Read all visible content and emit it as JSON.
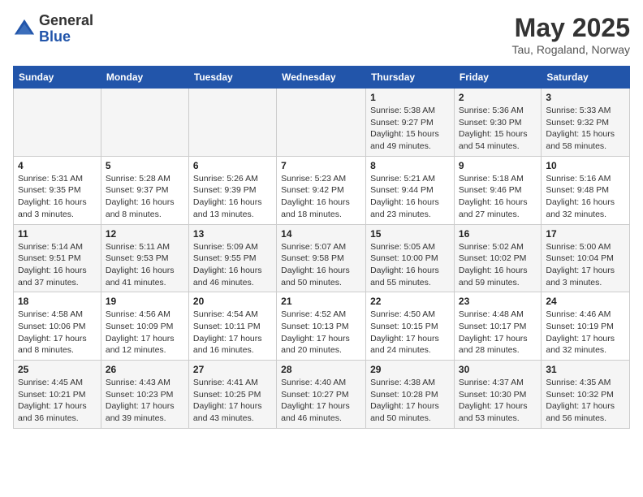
{
  "header": {
    "logo_general": "General",
    "logo_blue": "Blue",
    "month_title": "May 2025",
    "location": "Tau, Rogaland, Norway"
  },
  "days_of_week": [
    "Sunday",
    "Monday",
    "Tuesday",
    "Wednesday",
    "Thursday",
    "Friday",
    "Saturday"
  ],
  "weeks": [
    [
      {
        "day": "",
        "info": ""
      },
      {
        "day": "",
        "info": ""
      },
      {
        "day": "",
        "info": ""
      },
      {
        "day": "",
        "info": ""
      },
      {
        "day": "1",
        "info": "Sunrise: 5:38 AM\nSunset: 9:27 PM\nDaylight: 15 hours\nand 49 minutes."
      },
      {
        "day": "2",
        "info": "Sunrise: 5:36 AM\nSunset: 9:30 PM\nDaylight: 15 hours\nand 54 minutes."
      },
      {
        "day": "3",
        "info": "Sunrise: 5:33 AM\nSunset: 9:32 PM\nDaylight: 15 hours\nand 58 minutes."
      }
    ],
    [
      {
        "day": "4",
        "info": "Sunrise: 5:31 AM\nSunset: 9:35 PM\nDaylight: 16 hours\nand 3 minutes."
      },
      {
        "day": "5",
        "info": "Sunrise: 5:28 AM\nSunset: 9:37 PM\nDaylight: 16 hours\nand 8 minutes."
      },
      {
        "day": "6",
        "info": "Sunrise: 5:26 AM\nSunset: 9:39 PM\nDaylight: 16 hours\nand 13 minutes."
      },
      {
        "day": "7",
        "info": "Sunrise: 5:23 AM\nSunset: 9:42 PM\nDaylight: 16 hours\nand 18 minutes."
      },
      {
        "day": "8",
        "info": "Sunrise: 5:21 AM\nSunset: 9:44 PM\nDaylight: 16 hours\nand 23 minutes."
      },
      {
        "day": "9",
        "info": "Sunrise: 5:18 AM\nSunset: 9:46 PM\nDaylight: 16 hours\nand 27 minutes."
      },
      {
        "day": "10",
        "info": "Sunrise: 5:16 AM\nSunset: 9:48 PM\nDaylight: 16 hours\nand 32 minutes."
      }
    ],
    [
      {
        "day": "11",
        "info": "Sunrise: 5:14 AM\nSunset: 9:51 PM\nDaylight: 16 hours\nand 37 minutes."
      },
      {
        "day": "12",
        "info": "Sunrise: 5:11 AM\nSunset: 9:53 PM\nDaylight: 16 hours\nand 41 minutes."
      },
      {
        "day": "13",
        "info": "Sunrise: 5:09 AM\nSunset: 9:55 PM\nDaylight: 16 hours\nand 46 minutes."
      },
      {
        "day": "14",
        "info": "Sunrise: 5:07 AM\nSunset: 9:58 PM\nDaylight: 16 hours\nand 50 minutes."
      },
      {
        "day": "15",
        "info": "Sunrise: 5:05 AM\nSunset: 10:00 PM\nDaylight: 16 hours\nand 55 minutes."
      },
      {
        "day": "16",
        "info": "Sunrise: 5:02 AM\nSunset: 10:02 PM\nDaylight: 16 hours\nand 59 minutes."
      },
      {
        "day": "17",
        "info": "Sunrise: 5:00 AM\nSunset: 10:04 PM\nDaylight: 17 hours\nand 3 minutes."
      }
    ],
    [
      {
        "day": "18",
        "info": "Sunrise: 4:58 AM\nSunset: 10:06 PM\nDaylight: 17 hours\nand 8 minutes."
      },
      {
        "day": "19",
        "info": "Sunrise: 4:56 AM\nSunset: 10:09 PM\nDaylight: 17 hours\nand 12 minutes."
      },
      {
        "day": "20",
        "info": "Sunrise: 4:54 AM\nSunset: 10:11 PM\nDaylight: 17 hours\nand 16 minutes."
      },
      {
        "day": "21",
        "info": "Sunrise: 4:52 AM\nSunset: 10:13 PM\nDaylight: 17 hours\nand 20 minutes."
      },
      {
        "day": "22",
        "info": "Sunrise: 4:50 AM\nSunset: 10:15 PM\nDaylight: 17 hours\nand 24 minutes."
      },
      {
        "day": "23",
        "info": "Sunrise: 4:48 AM\nSunset: 10:17 PM\nDaylight: 17 hours\nand 28 minutes."
      },
      {
        "day": "24",
        "info": "Sunrise: 4:46 AM\nSunset: 10:19 PM\nDaylight: 17 hours\nand 32 minutes."
      }
    ],
    [
      {
        "day": "25",
        "info": "Sunrise: 4:45 AM\nSunset: 10:21 PM\nDaylight: 17 hours\nand 36 minutes."
      },
      {
        "day": "26",
        "info": "Sunrise: 4:43 AM\nSunset: 10:23 PM\nDaylight: 17 hours\nand 39 minutes."
      },
      {
        "day": "27",
        "info": "Sunrise: 4:41 AM\nSunset: 10:25 PM\nDaylight: 17 hours\nand 43 minutes."
      },
      {
        "day": "28",
        "info": "Sunrise: 4:40 AM\nSunset: 10:27 PM\nDaylight: 17 hours\nand 46 minutes."
      },
      {
        "day": "29",
        "info": "Sunrise: 4:38 AM\nSunset: 10:28 PM\nDaylight: 17 hours\nand 50 minutes."
      },
      {
        "day": "30",
        "info": "Sunrise: 4:37 AM\nSunset: 10:30 PM\nDaylight: 17 hours\nand 53 minutes."
      },
      {
        "day": "31",
        "info": "Sunrise: 4:35 AM\nSunset: 10:32 PM\nDaylight: 17 hours\nand 56 minutes."
      }
    ]
  ]
}
